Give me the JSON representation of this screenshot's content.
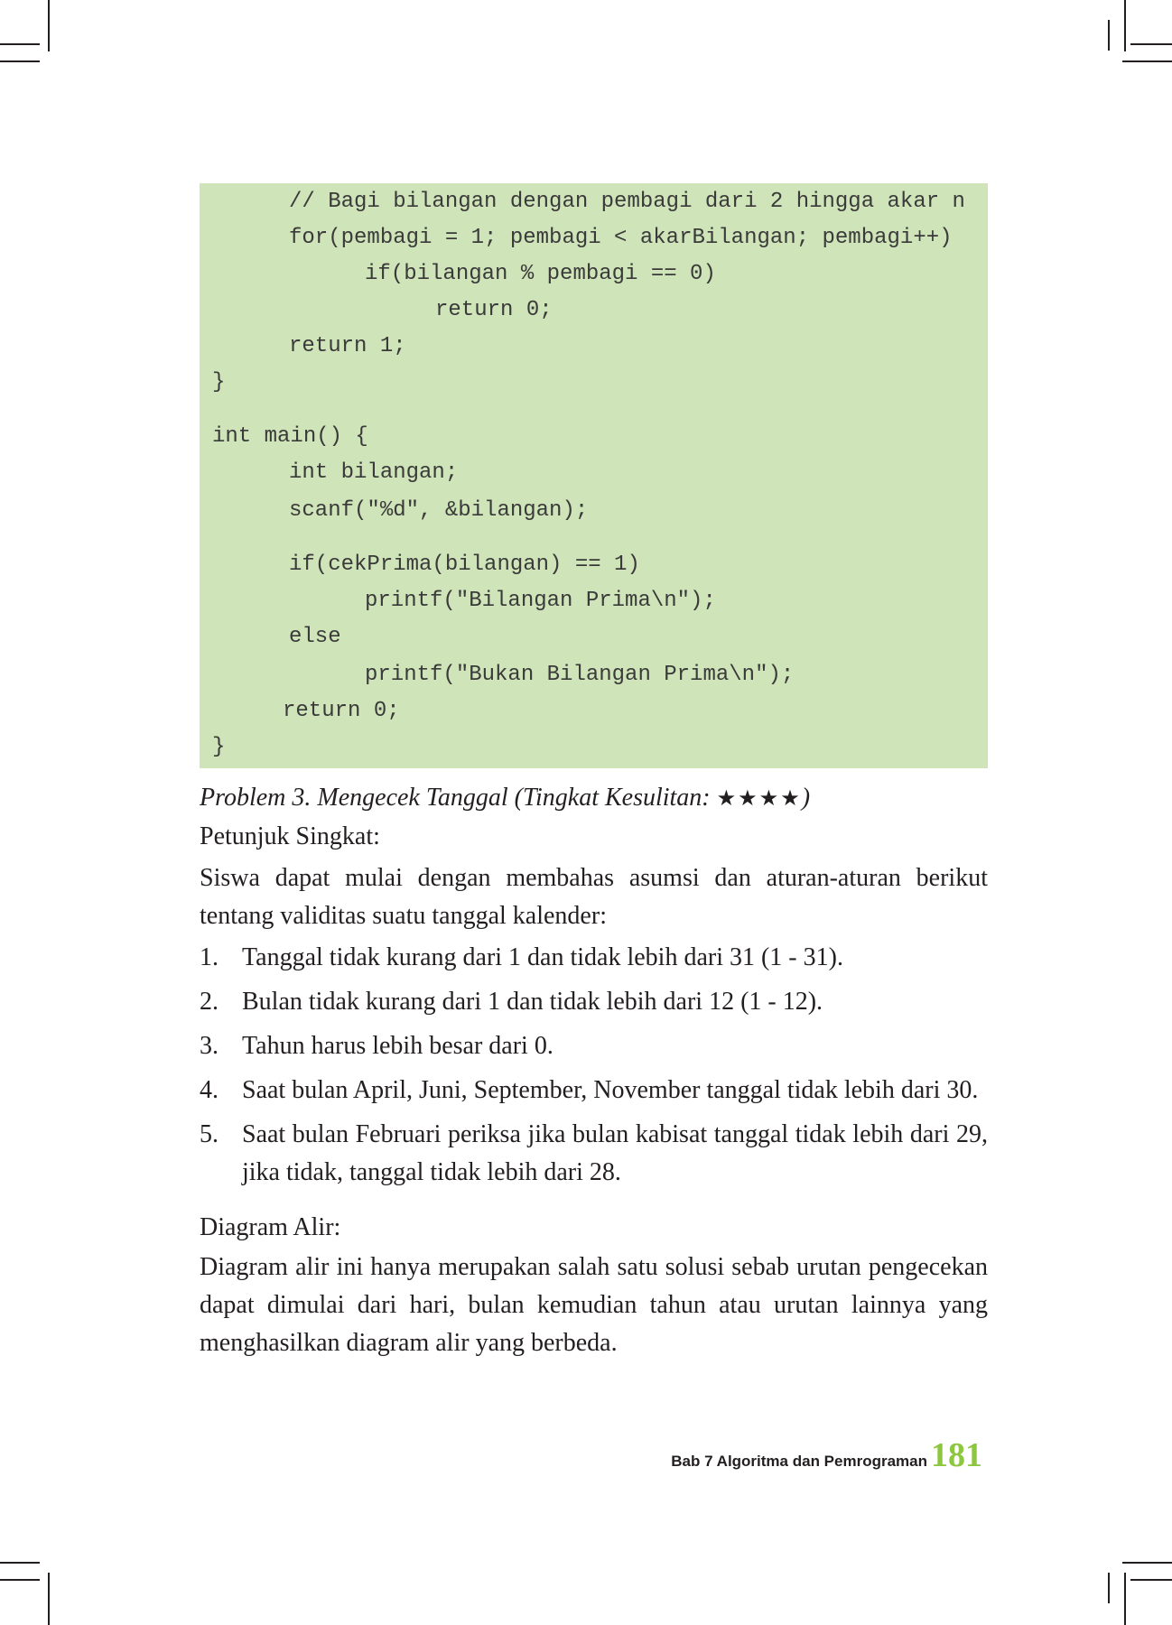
{
  "code": {
    "lines": [
      "// Bagi bilangan dengan pembagi dari 2 hingga akar n",
      "for(pembagi = 1; pembagi < akarBilangan; pembagi++)",
      "if(bilangan % pembagi == 0)",
      "return 0;",
      "return 1;",
      "}",
      "int main() {",
      "int bilangan;",
      "scanf(\"%d\", &bilangan);",
      "if(cekPrima(bilangan) == 1)",
      "printf(\"Bilangan Prima\\n\");",
      "else",
      "printf(\"Bukan Bilangan Prima\\n\");",
      "return 0;",
      "}"
    ]
  },
  "problem": {
    "title": "Problem 3. Mengecek Tanggal (Tingkat Kesulitan: ",
    "stars": "★★★★",
    "title_end": ")",
    "hint_heading": "Petunjuk Singkat:",
    "hint_text": "Siswa dapat mulai dengan membahas asumsi dan aturan-aturan berikut tentang validitas suatu tanggal kalender:",
    "rules": [
      {
        "num": "1.",
        "text": "Tanggal tidak kurang dari 1 dan tidak lebih dari 31 (1 - 31)."
      },
      {
        "num": "2.",
        "text": "Bulan tidak kurang dari 1 dan tidak lebih dari 12 (1 - 12)."
      },
      {
        "num": "3.",
        "text": "Tahun harus lebih besar dari 0."
      },
      {
        "num": "4.",
        "text": "Saat bulan April, Juni, September, November tanggal tidak lebih dari 30."
      },
      {
        "num": "5.",
        "text": "Saat bulan Februari periksa jika bulan kabisat tanggal tidak lebih dari 29, jika tidak, tanggal tidak lebih dari 28."
      }
    ],
    "flow_heading": "Diagram Alir:",
    "flow_text": "Diagram alir ini hanya merupakan salah satu solusi sebab urutan pengecekan dapat dimulai dari hari, bulan kemudian tahun atau urutan lainnya yang menghasilkan diagram alir yang berbeda."
  },
  "footer": {
    "chapter": "Bab 7 Algoritma dan Pemrograman",
    "page_number": "181"
  },
  "colors": {
    "code_background": "#cfe4b8",
    "page_number": "#8dc63f",
    "text": "#231f20"
  }
}
